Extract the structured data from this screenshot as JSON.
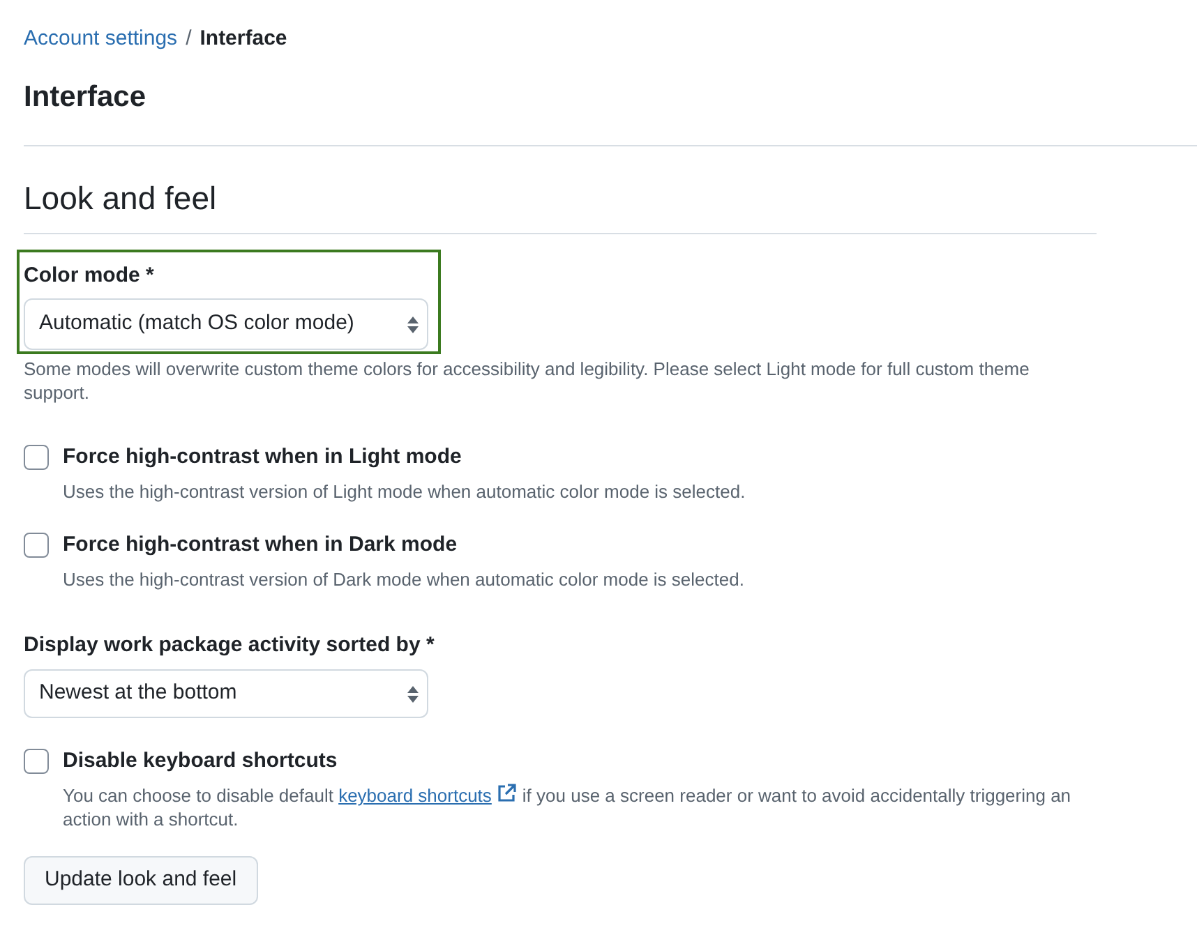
{
  "breadcrumb": {
    "parent": "Account settings",
    "separator": "/",
    "current": "Interface"
  },
  "page_title": "Interface",
  "section_title": "Look and feel",
  "color_mode": {
    "label": "Color mode *",
    "value": "Automatic (match OS color mode)",
    "highlighted": true,
    "help": "Some modes will overwrite custom theme colors for accessibility and legibility. Please select Light mode for full custom theme support."
  },
  "checkboxes": [
    {
      "label": "Force high-contrast when in Light mode",
      "description": "Uses the high-contrast version of Light mode when automatic color mode is selected.",
      "checked": false
    },
    {
      "label": "Force high-contrast when in Dark mode",
      "description": "Uses the high-contrast version of Dark mode when automatic color mode is selected.",
      "checked": false
    }
  ],
  "activity_sort": {
    "label": "Display work package activity sorted by *",
    "value": "Newest at the bottom"
  },
  "keyboard": {
    "label": "Disable keyboard shortcuts",
    "checked": false,
    "description_before": "You can choose to disable default",
    "link": "keyboard shortcuts",
    "description_after": "if you use a screen reader or want to avoid accidentally triggering an action with a shortcut."
  },
  "submit_button": "Update look and feel"
}
